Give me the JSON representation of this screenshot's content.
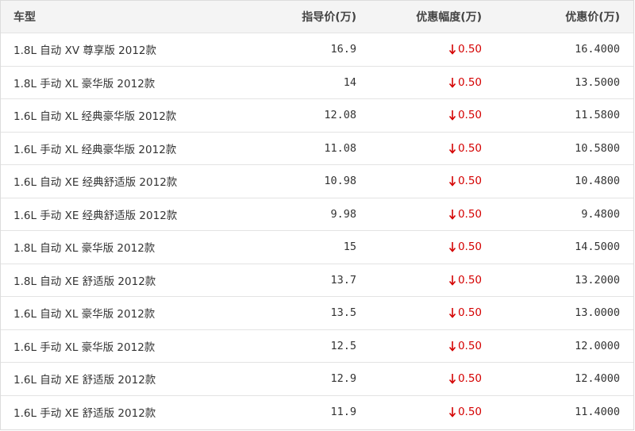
{
  "table": {
    "headers": {
      "model": "车型",
      "guide_price": "指导价(万)",
      "discount": "优惠幅度(万)",
      "final_price": "优惠价(万)"
    },
    "rows": [
      {
        "model": "1.8L 自动 XV 尊享版 2012款",
        "guide_price": "16.9",
        "discount": "0.50",
        "final_price": "16.4000"
      },
      {
        "model": "1.8L 手动 XL 豪华版 2012款",
        "guide_price": "14",
        "discount": "0.50",
        "final_price": "13.5000"
      },
      {
        "model": "1.6L 自动 XL 经典豪华版 2012款",
        "guide_price": "12.08",
        "discount": "0.50",
        "final_price": "11.5800"
      },
      {
        "model": "1.6L 手动 XL 经典豪华版 2012款",
        "guide_price": "11.08",
        "discount": "0.50",
        "final_price": "10.5800"
      },
      {
        "model": "1.6L 自动 XE 经典舒适版 2012款",
        "guide_price": "10.98",
        "discount": "0.50",
        "final_price": "10.4800"
      },
      {
        "model": "1.6L 手动 XE 经典舒适版 2012款",
        "guide_price": "9.98",
        "discount": "0.50",
        "final_price": "9.4800"
      },
      {
        "model": "1.8L 自动 XL 豪华版 2012款",
        "guide_price": "15",
        "discount": "0.50",
        "final_price": "14.5000"
      },
      {
        "model": "1.8L 自动 XE 舒适版 2012款",
        "guide_price": "13.7",
        "discount": "0.50",
        "final_price": "13.2000"
      },
      {
        "model": "1.6L 自动 XL 豪华版 2012款",
        "guide_price": "13.5",
        "discount": "0.50",
        "final_price": "13.0000"
      },
      {
        "model": "1.6L 手动 XL 豪华版 2012款",
        "guide_price": "12.5",
        "discount": "0.50",
        "final_price": "12.0000"
      },
      {
        "model": "1.6L 自动 XE 舒适版 2012款",
        "guide_price": "12.9",
        "discount": "0.50",
        "final_price": "12.4000"
      },
      {
        "model": "1.6L 手动 XE 舒适版 2012款",
        "guide_price": "11.9",
        "discount": "0.50",
        "final_price": "11.4000"
      }
    ]
  },
  "icons": {
    "discount": "down-arrow-icon"
  },
  "colors": {
    "discount": "#d40000",
    "header_bg": "#f4f4f4",
    "border": "#dcdcdc"
  }
}
